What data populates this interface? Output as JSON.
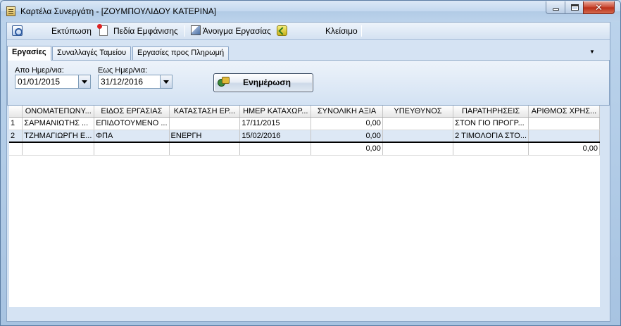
{
  "window": {
    "title": "Καρτέλα Συνεργάτη - [ΖΟΥΜΠΟΥΛΙΔΟΥ ΚΑΤΕΡΙΝΑ]",
    "icon": "card-file-icon",
    "min_icon": "minimize-icon",
    "max_icon": "maximize-icon",
    "close_glyph": "✕"
  },
  "toolbar": {
    "print_label": "Εκτύπωση",
    "fields_label": "Πεδία Εμφάνισης",
    "open_job_label": "Άνοιγμα Εργασίας",
    "close_label": "Κλείσιμο"
  },
  "tabs": [
    {
      "label": "Εργασίες",
      "active": true
    },
    {
      "label": "Συναλλαγές Ταμείου",
      "active": false
    },
    {
      "label": "Εργασίες προς Πληρωμή",
      "active": false
    }
  ],
  "tab_dropdown": "▼",
  "filters": {
    "from_label": "Απο Ημερ/νια:",
    "from_value": "01/01/2015",
    "to_label": "Εως Ημερ/νια:",
    "to_value": "31/12/2016",
    "update_label": "Ενημέρωση"
  },
  "grid": {
    "columns": [
      "",
      "ΟΝΟΜΑΤΕΠΩΝΥ...",
      "ΕΙΔΟΣ ΕΡΓΑΣΙΑΣ",
      "ΚΑΤΑΣΤΑΣΗ ΕΡ...",
      "ΗΜΕΡ ΚΑΤΑΧΩΡ...",
      "ΣΥΝΟΛΙΚΗ ΑΞΙΑ",
      "ΥΠΕΥΘΥΝΟΣ",
      "ΠΑΡΑΤΗΡΗΣΕΙΣ",
      "ΑΡΙΘΜΟΣ ΧΡΗΣ..."
    ],
    "rows": [
      [
        "1",
        "ΣΑΡΜΑΝΙΩΤΗΣ ...",
        "ΕΠΙΔΟΤΟΥΜΕΝΟ ...",
        "",
        "17/11/2015",
        "0,00",
        "",
        "ΣΤΟΝ ΓΙΟ ΠΡΟΓΡ...",
        ""
      ],
      [
        "2",
        "ΤΖΗΜΑΓΙΩΡΓΗ Ε...",
        "ΦΠΑ",
        "ΕΝΕΡΓΗ",
        "15/02/2016",
        "0,00",
        "",
        "2 ΤΙΜΟΛΟΓΙΑ ΣΤΟ...",
        ""
      ]
    ],
    "totals": [
      "",
      "",
      "",
      "",
      "",
      "0,00",
      "",
      "",
      "0,00"
    ]
  }
}
